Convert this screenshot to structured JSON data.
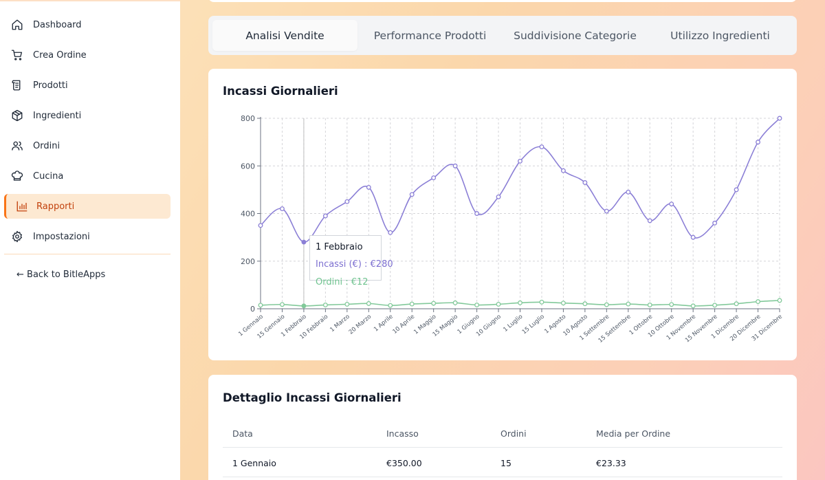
{
  "sidebar": {
    "items": [
      {
        "label": "Dashboard",
        "icon": "home-icon"
      },
      {
        "label": "Crea Ordine",
        "icon": "cart-icon"
      },
      {
        "label": "Prodotti",
        "icon": "scroll-icon"
      },
      {
        "label": "Ingredienti",
        "icon": "package-icon"
      },
      {
        "label": "Ordini",
        "icon": "users-icon"
      },
      {
        "label": "Cucina",
        "icon": "chef-hat-icon"
      },
      {
        "label": "Rapporti",
        "icon": "bar-chart-icon",
        "active": true
      },
      {
        "label": "Impostazioni",
        "icon": "gear-icon"
      }
    ],
    "back_link": "← Back to BitleApps"
  },
  "tabs": [
    "Analisi Vendite",
    "Performance Prodotti",
    "Suddivisione Categorie",
    "Utilizzo Ingredienti"
  ],
  "chart_card": {
    "title": "Incassi Giornalieri",
    "tooltip": {
      "title": "1 Febbraio",
      "incassi": "Incassi (€) : €280",
      "ordini": "Ordini : €12"
    }
  },
  "chart_data": {
    "type": "line",
    "x": [
      "1 Gennaio",
      "15 Gennaio",
      "1 Febbraio",
      "10 Febbraio",
      "1 Marzo",
      "20 Marzo",
      "1 Aprile",
      "10 Aprile",
      "1 Maggio",
      "15 Maggio",
      "1 Giugno",
      "10 Giugno",
      "1 Luglio",
      "15 Luglio",
      "1 Agosto",
      "10 Agosto",
      "1 Settembre",
      "15 Settembre",
      "1 Ottobre",
      "10 Ottobre",
      "1 Novembre",
      "15 Novembre",
      "1 Dicembre",
      "20 Dicembre",
      "31 Dicembre"
    ],
    "series": [
      {
        "name": "Incassi (€)",
        "color": "#8b7fd6",
        "values": [
          350,
          420,
          280,
          390,
          450,
          510,
          320,
          480,
          550,
          600,
          400,
          470,
          620,
          680,
          580,
          530,
          410,
          490,
          370,
          440,
          300,
          360,
          500,
          700,
          800
        ]
      },
      {
        "name": "Ordini",
        "color": "#82c99a",
        "values": [
          15,
          18,
          12,
          16,
          19,
          22,
          14,
          20,
          23,
          25,
          16,
          19,
          25,
          28,
          24,
          21,
          17,
          20,
          16,
          18,
          12,
          15,
          21,
          30,
          35
        ]
      }
    ],
    "yticks": [
      0,
      200,
      400,
      600,
      800
    ],
    "ylim": [
      0,
      800
    ],
    "grid": true,
    "highlight_index": 2
  },
  "table_card": {
    "title": "Dettaglio Incassi Giornalieri",
    "headers": [
      "Data",
      "Incasso",
      "Ordini",
      "Media per Ordine"
    ],
    "rows": [
      [
        "1 Gennaio",
        "€350.00",
        "15",
        "€23.33"
      ]
    ]
  }
}
